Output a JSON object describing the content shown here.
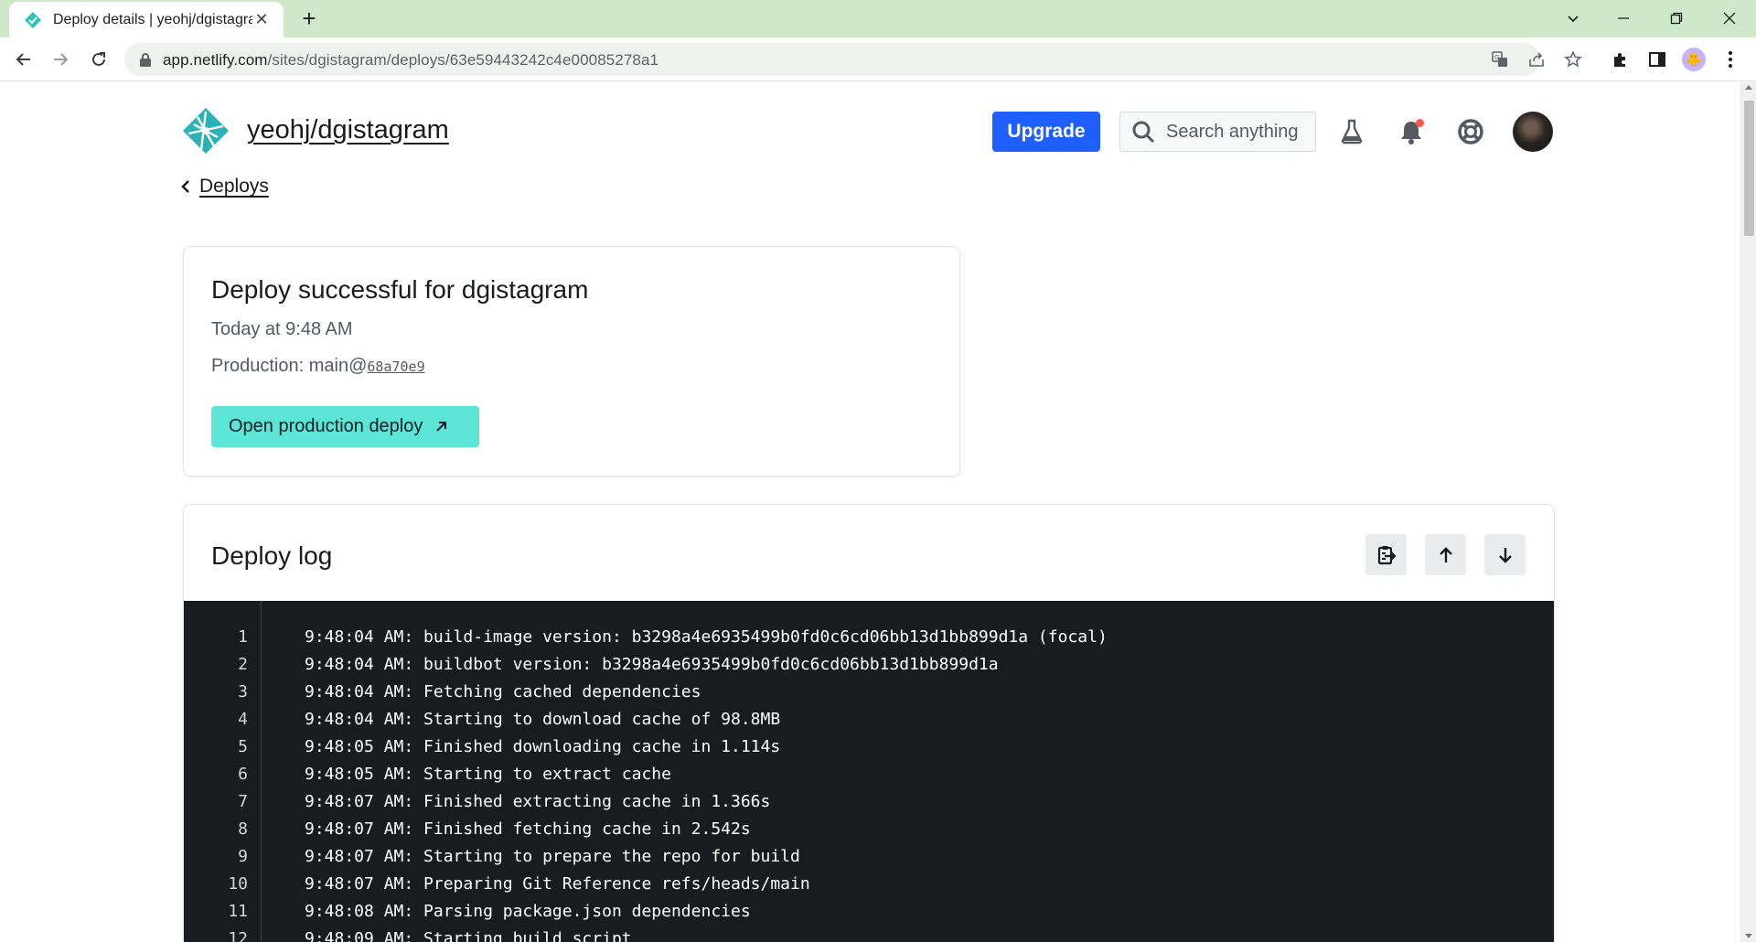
{
  "browser": {
    "tab_title": "Deploy details | yeohj/dgistagram",
    "url_host": "app.netlify.com",
    "url_path": "/sites/dgistagram/deploys/63e59443242c4e00085278a1"
  },
  "header": {
    "site_name": "yeohj/dgistagram",
    "upgrade_label": "Upgrade",
    "search_placeholder": "Search anything"
  },
  "breadcrumb": {
    "back_label": "Deploys"
  },
  "deploy": {
    "title": "Deploy successful for dgistagram",
    "time": "Today at 9:48 AM",
    "production_label": "Production: ",
    "branch": "main@",
    "commit": "68a70e9",
    "open_button_label": "Open production deploy"
  },
  "log": {
    "title": "Deploy log",
    "lines": [
      {
        "num": "1",
        "text": "9:48:04 AM: build-image version: b3298a4e6935499b0fd0c6cd06bb13d1bb899d1a (focal)"
      },
      {
        "num": "2",
        "text": "9:48:04 AM: buildbot version: b3298a4e6935499b0fd0c6cd06bb13d1bb899d1a"
      },
      {
        "num": "3",
        "text": "9:48:04 AM: Fetching cached dependencies"
      },
      {
        "num": "4",
        "text": "9:48:04 AM: Starting to download cache of 98.8MB"
      },
      {
        "num": "5",
        "text": "9:48:05 AM: Finished downloading cache in 1.114s"
      },
      {
        "num": "6",
        "text": "9:48:05 AM: Starting to extract cache"
      },
      {
        "num": "7",
        "text": "9:48:07 AM: Finished extracting cache in 1.366s"
      },
      {
        "num": "8",
        "text": "9:48:07 AM: Finished fetching cache in 2.542s"
      },
      {
        "num": "9",
        "text": "9:48:07 AM: Starting to prepare the repo for build"
      },
      {
        "num": "10",
        "text": "9:48:07 AM: Preparing Git Reference refs/heads/main"
      },
      {
        "num": "11",
        "text": "9:48:08 AM: Parsing package.json dependencies"
      },
      {
        "num": "12",
        "text": "9:48:09 AM: Starting build script"
      }
    ]
  },
  "colors": {
    "tabstrip": "#cfe8c9",
    "upgrade_button": "#1f5fff",
    "open_button": "#5ce5d7",
    "log_background": "#181b20",
    "netlify_teal": "#32c3b8"
  },
  "icons": {
    "tab_favicon": "netlify-logo-icon",
    "lab": "flask-icon",
    "notifications": "bell-icon",
    "help": "lifebuoy-icon",
    "copy_log": "clipboard-copy-icon",
    "scroll_top": "arrow-up-icon",
    "scroll_bottom": "arrow-down-icon"
  }
}
